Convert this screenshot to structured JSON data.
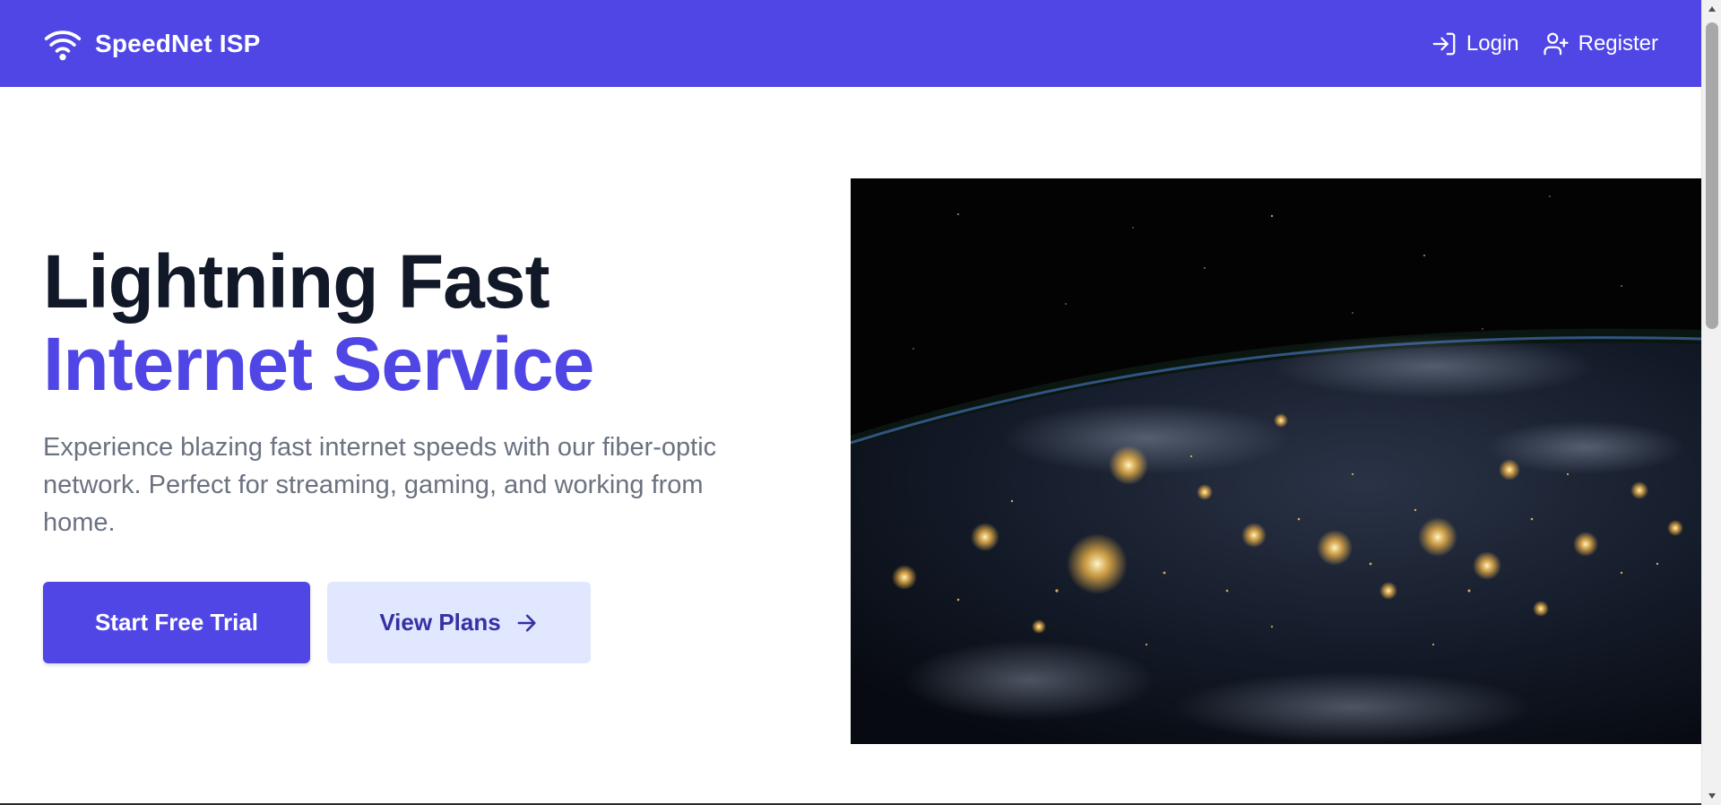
{
  "header": {
    "brand_name": "SpeedNet ISP",
    "brand_icon": "wifi-icon",
    "nav": [
      {
        "label": "Login",
        "icon": "login-icon"
      },
      {
        "label": "Register",
        "icon": "user-plus-icon"
      }
    ]
  },
  "hero": {
    "headline_line1": "Lightning Fast",
    "headline_line2": "Internet Service",
    "description": "Experience blazing fast internet speeds with our fiber-optic network. Perfect for streaming, gaming, and working from home.",
    "primary_button": "Start Free Trial",
    "secondary_button": "View Plans",
    "secondary_icon": "arrow-right-icon"
  },
  "colors": {
    "brand": "#4f46e5",
    "heading": "#111827",
    "body_text": "#6b7280",
    "secondary_bg": "#e0e7ff",
    "secondary_text": "#3730a3"
  }
}
